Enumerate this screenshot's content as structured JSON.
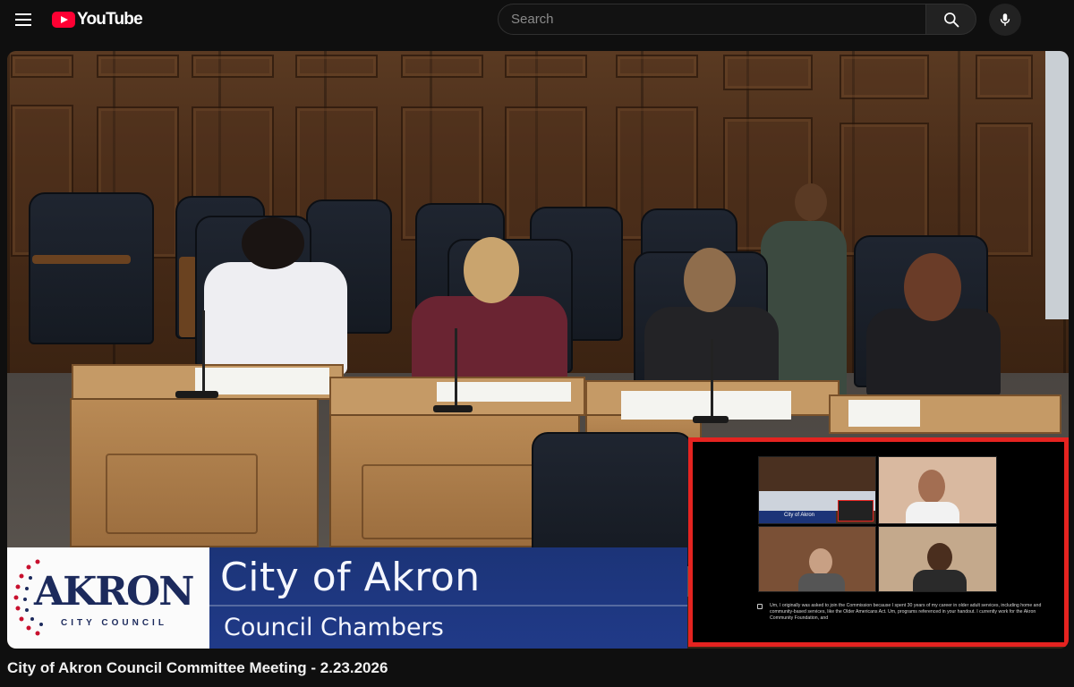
{
  "header": {
    "logo_text": "YouTube",
    "search_placeholder": "Search",
    "icons": {
      "menu": "hamburger-menu-icon",
      "search": "search-icon",
      "mic": "microphone-icon"
    }
  },
  "video": {
    "lower_third": {
      "logo_main": "AKRON",
      "logo_sub": "CITY COUNCIL",
      "title": "City of Akron",
      "subtitle": "Council Chambers"
    },
    "inset": {
      "tile_label": "City of Akron",
      "caption": "Um, I originally was asked to join the Commission because I spent 30 years of my career in older adult services, including home and community-based services, like the Older Americans Act. Um, programs referenced in your handout. I currently work for the Akron Community Foundation, and"
    }
  },
  "title": "City of Akron Council Committee Meeting - 2.23.2026",
  "colors": {
    "brand_red": "#ff0033",
    "lower_third_blue": "#1c3478",
    "inset_border": "#e52320"
  }
}
